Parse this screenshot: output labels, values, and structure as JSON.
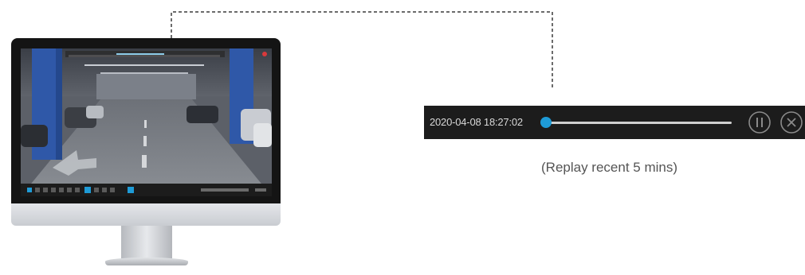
{
  "playback": {
    "timestamp": "2020-04-08 18:27:02",
    "progress": 0.0,
    "accent_color": "#1e9bd7",
    "controls": [
      {
        "name": "pause",
        "icon": "pause-circle-icon"
      },
      {
        "name": "close",
        "icon": "close-circle-icon"
      }
    ]
  },
  "caption": {
    "text": "(Replay recent 5 mins)"
  },
  "monitor": {
    "screen_content": "parking-garage-camera-view"
  }
}
